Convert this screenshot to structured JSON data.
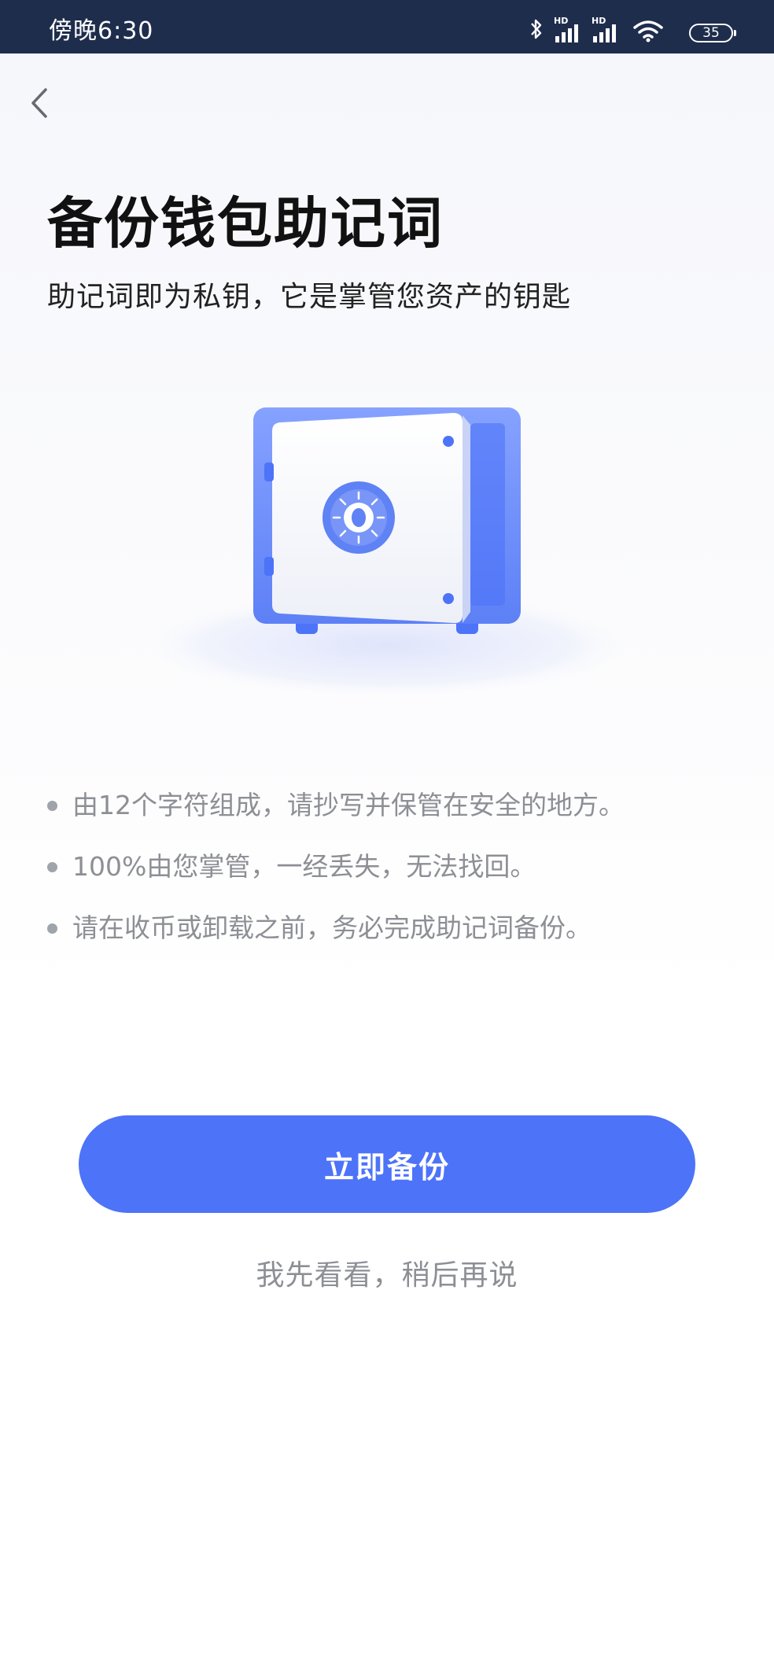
{
  "status_bar": {
    "time": "傍晚6:30",
    "network_1": "HD",
    "network_2": "HD",
    "battery": "35",
    "icons": [
      "bluetooth-icon",
      "signal-icon",
      "signal-icon",
      "wifi-icon",
      "battery-icon"
    ]
  },
  "header": {
    "back_icon": "chevron-left-icon"
  },
  "page": {
    "title": "备份钱包助记词",
    "subtitle": "助记词即为私钥，它是掌管您资产的钥匙",
    "illustration": "safe-illustration"
  },
  "tips": [
    "由12个字符组成，请抄写并保管在安全的地方。",
    "100%由您掌管，一经丢失，无法找回。",
    "请在收币或卸载之前，务必完成助记词备份。"
  ],
  "actions": {
    "primary_label": "立即备份",
    "secondary_label": "我先看看，稍后再说"
  },
  "colors": {
    "status_bar": "#1f2d4d",
    "accent": "#4d73f8",
    "muted_text": "#8d8f95"
  }
}
